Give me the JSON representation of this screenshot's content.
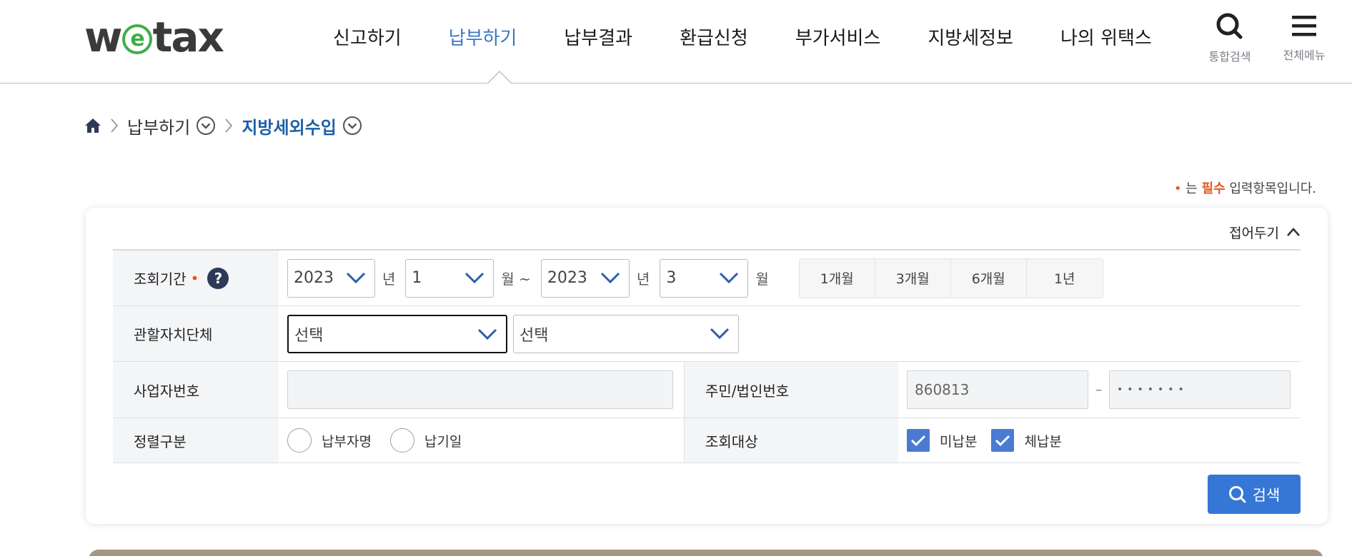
{
  "header": {
    "logo_text": "wetax",
    "nav": [
      {
        "label": "신고하기",
        "active": false
      },
      {
        "label": "납부하기",
        "active": true
      },
      {
        "label": "납부결과",
        "active": false
      },
      {
        "label": "환급신청",
        "active": false
      },
      {
        "label": "부가서비스",
        "active": false
      },
      {
        "label": "지방세정보",
        "active": false
      },
      {
        "label": "나의 위택스",
        "active": false
      }
    ],
    "search_label": "통합검색",
    "search_icon": "search-icon",
    "menu_label": "전체메뉴",
    "menu_icon": "hamburger-icon"
  },
  "breadcrumb": {
    "items": [
      "납부하기",
      "지방세외수입"
    ]
  },
  "required_note": {
    "dot": "•",
    "prefix": "는 ",
    "word": "필수",
    "suffix": " 입력항목입니다."
  },
  "form": {
    "fold_label": "접어두기",
    "period": {
      "label": "조회기간",
      "required_dot": "•",
      "help": "?",
      "from_year": "2023",
      "from_month": "1",
      "to_year": "2023",
      "to_month": "3",
      "unit_year": "년",
      "unit_month_tilde": "월 ~",
      "unit_month": "월",
      "quick": [
        "1개월",
        "3개월",
        "6개월",
        "1년"
      ]
    },
    "jurisdiction": {
      "label": "관할자치단체",
      "select1": "선택",
      "select2": "선택"
    },
    "business_no": {
      "label": "사업자번호",
      "value": ""
    },
    "resident_no": {
      "label": "주민/법인번호",
      "front": "860813",
      "dash": "–",
      "back": "•••••••"
    },
    "sort": {
      "label": "정렬구분",
      "options": [
        "납부자명",
        "납기일"
      ]
    },
    "target": {
      "label": "조회대상",
      "options": [
        {
          "label": "미납분",
          "checked": true
        },
        {
          "label": "체납분",
          "checked": true
        }
      ]
    },
    "search_button": "검색"
  },
  "colors": {
    "accent": "#3677d6",
    "nav_active": "#3b78c4",
    "required": "#e05a1f",
    "logo_green": "#3fae49"
  }
}
